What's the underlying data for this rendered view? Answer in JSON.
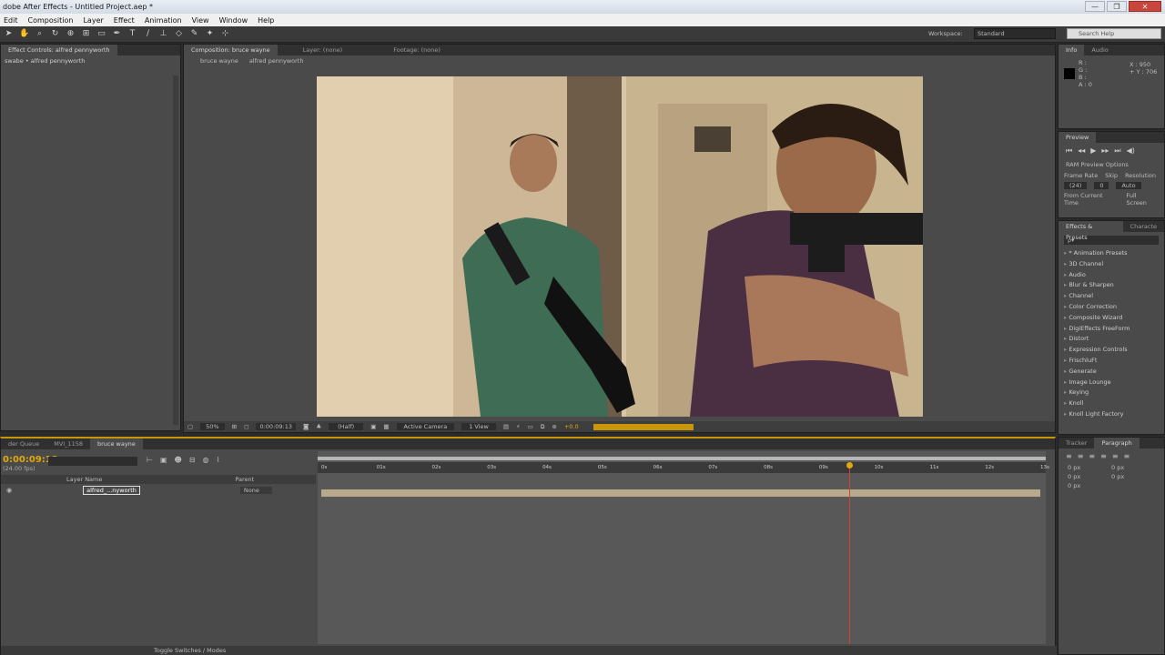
{
  "app": {
    "title": "dobe After Effects - Untitled Project.aep *"
  },
  "window": {
    "minimize": "—",
    "maximize": "❐",
    "close": "✕"
  },
  "menu": [
    "Edit",
    "Composition",
    "Layer",
    "Effect",
    "Animation",
    "View",
    "Window",
    "Help"
  ],
  "workspace": {
    "label": "Workspace:",
    "value": "Standard",
    "search_placeholder": "Search Help"
  },
  "effect_controls": {
    "tab": "Effect Controls: alfred pennyworth",
    "breadcrumb": "swabe • alfred pennyworth"
  },
  "viewer": {
    "tabs": [
      "Composition: bruce wayne",
      "Layer: (none)",
      "Footage: (none)"
    ],
    "breadcrumbs": [
      "bruce wayne",
      "alfred pennyworth"
    ],
    "zoom": "50%",
    "timecode": "0:00:09:13",
    "resolution": "(Half)",
    "camera": "Active Camera",
    "views": "1 View",
    "exposure": "+0.0"
  },
  "info": {
    "tabs": [
      "Info",
      "Audio"
    ],
    "rgb": [
      "R :",
      "G :",
      "B :",
      "A : 0"
    ],
    "coords": [
      "X : 950",
      "+ Y : 706"
    ]
  },
  "preview": {
    "tab": "Preview",
    "options": "RAM Preview Options",
    "labels": [
      "Frame Rate",
      "Skip",
      "Resolution"
    ],
    "values": [
      "(24)",
      "0",
      "Auto"
    ],
    "checks": [
      "From Current Time",
      "Full Screen"
    ]
  },
  "effects_presets": {
    "tabs": [
      "Effects & Presets",
      "Characte"
    ],
    "search": "ρ▾",
    "items": [
      "* Animation Presets",
      "3D Channel",
      "Audio",
      "Blur & Sharpen",
      "Channel",
      "Color Correction",
      "Composite Wizard",
      "DigiEffects FreeForm",
      "Distort",
      "Expression Controls",
      "FrischluFt",
      "Generate",
      "Image Lounge",
      "Keying",
      "Knoll",
      "Knoll Light Factory"
    ]
  },
  "tracker": {
    "tabs": [
      "Tracker",
      "Paragraph"
    ],
    "fields": [
      "0 px",
      "0 px",
      "0 px",
      "0 px",
      "0 px"
    ]
  },
  "timeline": {
    "tabs": [
      "der Queue",
      "MVI_1158",
      "bruce wayne"
    ],
    "timecode": "0:00:09:13",
    "fps": "(24.00 fps)",
    "columns": [
      "Layer Name",
      "Parent"
    ],
    "layer": {
      "name": "alfred_...nyworth",
      "parent": "None"
    },
    "ruler": [
      "0s",
      "01s",
      "02s",
      "03s",
      "04s",
      "05s",
      "06s",
      "07s",
      "08s",
      "09s",
      "10s",
      "11s",
      "12s",
      "13s"
    ],
    "playhead_seconds": 9.54,
    "footer": "Toggle Switches / Modes"
  },
  "colors": {
    "accent": "#e1a80c",
    "playhead": "#d9412f",
    "panel": "#4a4a4a"
  }
}
